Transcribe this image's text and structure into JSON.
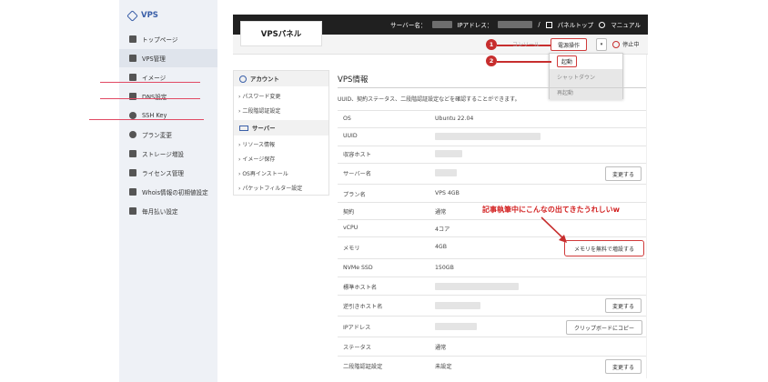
{
  "brand": "VPS",
  "sidebar": {
    "items": [
      {
        "label": "トップページ",
        "active": false
      },
      {
        "label": "VPS管理",
        "active": true
      },
      {
        "label": "イメージ",
        "active": false
      },
      {
        "label": "DNS設定",
        "active": false
      },
      {
        "label": "SSH Key",
        "active": false
      },
      {
        "label": "プラン変更",
        "active": false
      },
      {
        "label": "ストレージ増設",
        "active": false
      },
      {
        "label": "ライセンス管理",
        "active": false
      },
      {
        "label": "Whois情報の初期値設定",
        "active": false
      },
      {
        "label": "毎月払い設定",
        "active": false
      }
    ]
  },
  "topbar": {
    "server_label": "サーバー名：",
    "ip_label": "IPアドレス：",
    "separator": "/",
    "panel_top": "パネルトップ",
    "manual": "マニュアル"
  },
  "logo": "VPSパネル",
  "subbar": {
    "console": "コンソール",
    "power": "電源操作",
    "status": "停止中"
  },
  "annotations": {
    "step1": "1",
    "step2": "2",
    "note": "記事執筆中にこんなの出てきたうれしいw"
  },
  "dropdown": [
    "起動",
    "シャットダウン",
    "再起動"
  ],
  "side_panel": {
    "account_title": "アカウント",
    "account_links": [
      "パスワード変更",
      "二段階認証設定"
    ],
    "server_title": "サーバー",
    "server_links": [
      "リソース情報",
      "イメージ保存",
      "OS再インストール",
      "パケットフィルター設定"
    ]
  },
  "main": {
    "title": "VPS情報",
    "description": "UUID、契約ステータス、二段階認証設定などを確認することができます。",
    "rows": [
      {
        "label": "OS",
        "value": "Ubuntu 22.04",
        "button": ""
      },
      {
        "label": "UUID",
        "value": "",
        "button": ""
      },
      {
        "label": "収容ホスト",
        "value": "",
        "button": ""
      },
      {
        "label": "サーバー名",
        "value": "",
        "button": "変更する"
      },
      {
        "label": "プラン名",
        "value": "VPS 4GB",
        "button": ""
      },
      {
        "label": "契約",
        "value": "通常",
        "button": ""
      },
      {
        "label": "vCPU",
        "value": "4コア",
        "button": ""
      },
      {
        "label": "メモリ",
        "value": "4GB",
        "button": "メモリを無料で増設する"
      },
      {
        "label": "NVMe SSD",
        "value": "150GB",
        "button": ""
      },
      {
        "label": "標準ホスト名",
        "value": "",
        "button": ""
      },
      {
        "label": "逆引きホスト名",
        "value": "",
        "button": "変更する"
      },
      {
        "label": "IPアドレス",
        "value": "",
        "button": "クリップボードにコピー"
      },
      {
        "label": "ステータス",
        "value": "通常",
        "button": ""
      },
      {
        "label": "二段階認証設定",
        "value": "未設定",
        "button": "変更する"
      }
    ]
  },
  "colors": {
    "accent": "#3a5fa8",
    "annotation": "#c72e2e",
    "topbar": "#202020"
  }
}
